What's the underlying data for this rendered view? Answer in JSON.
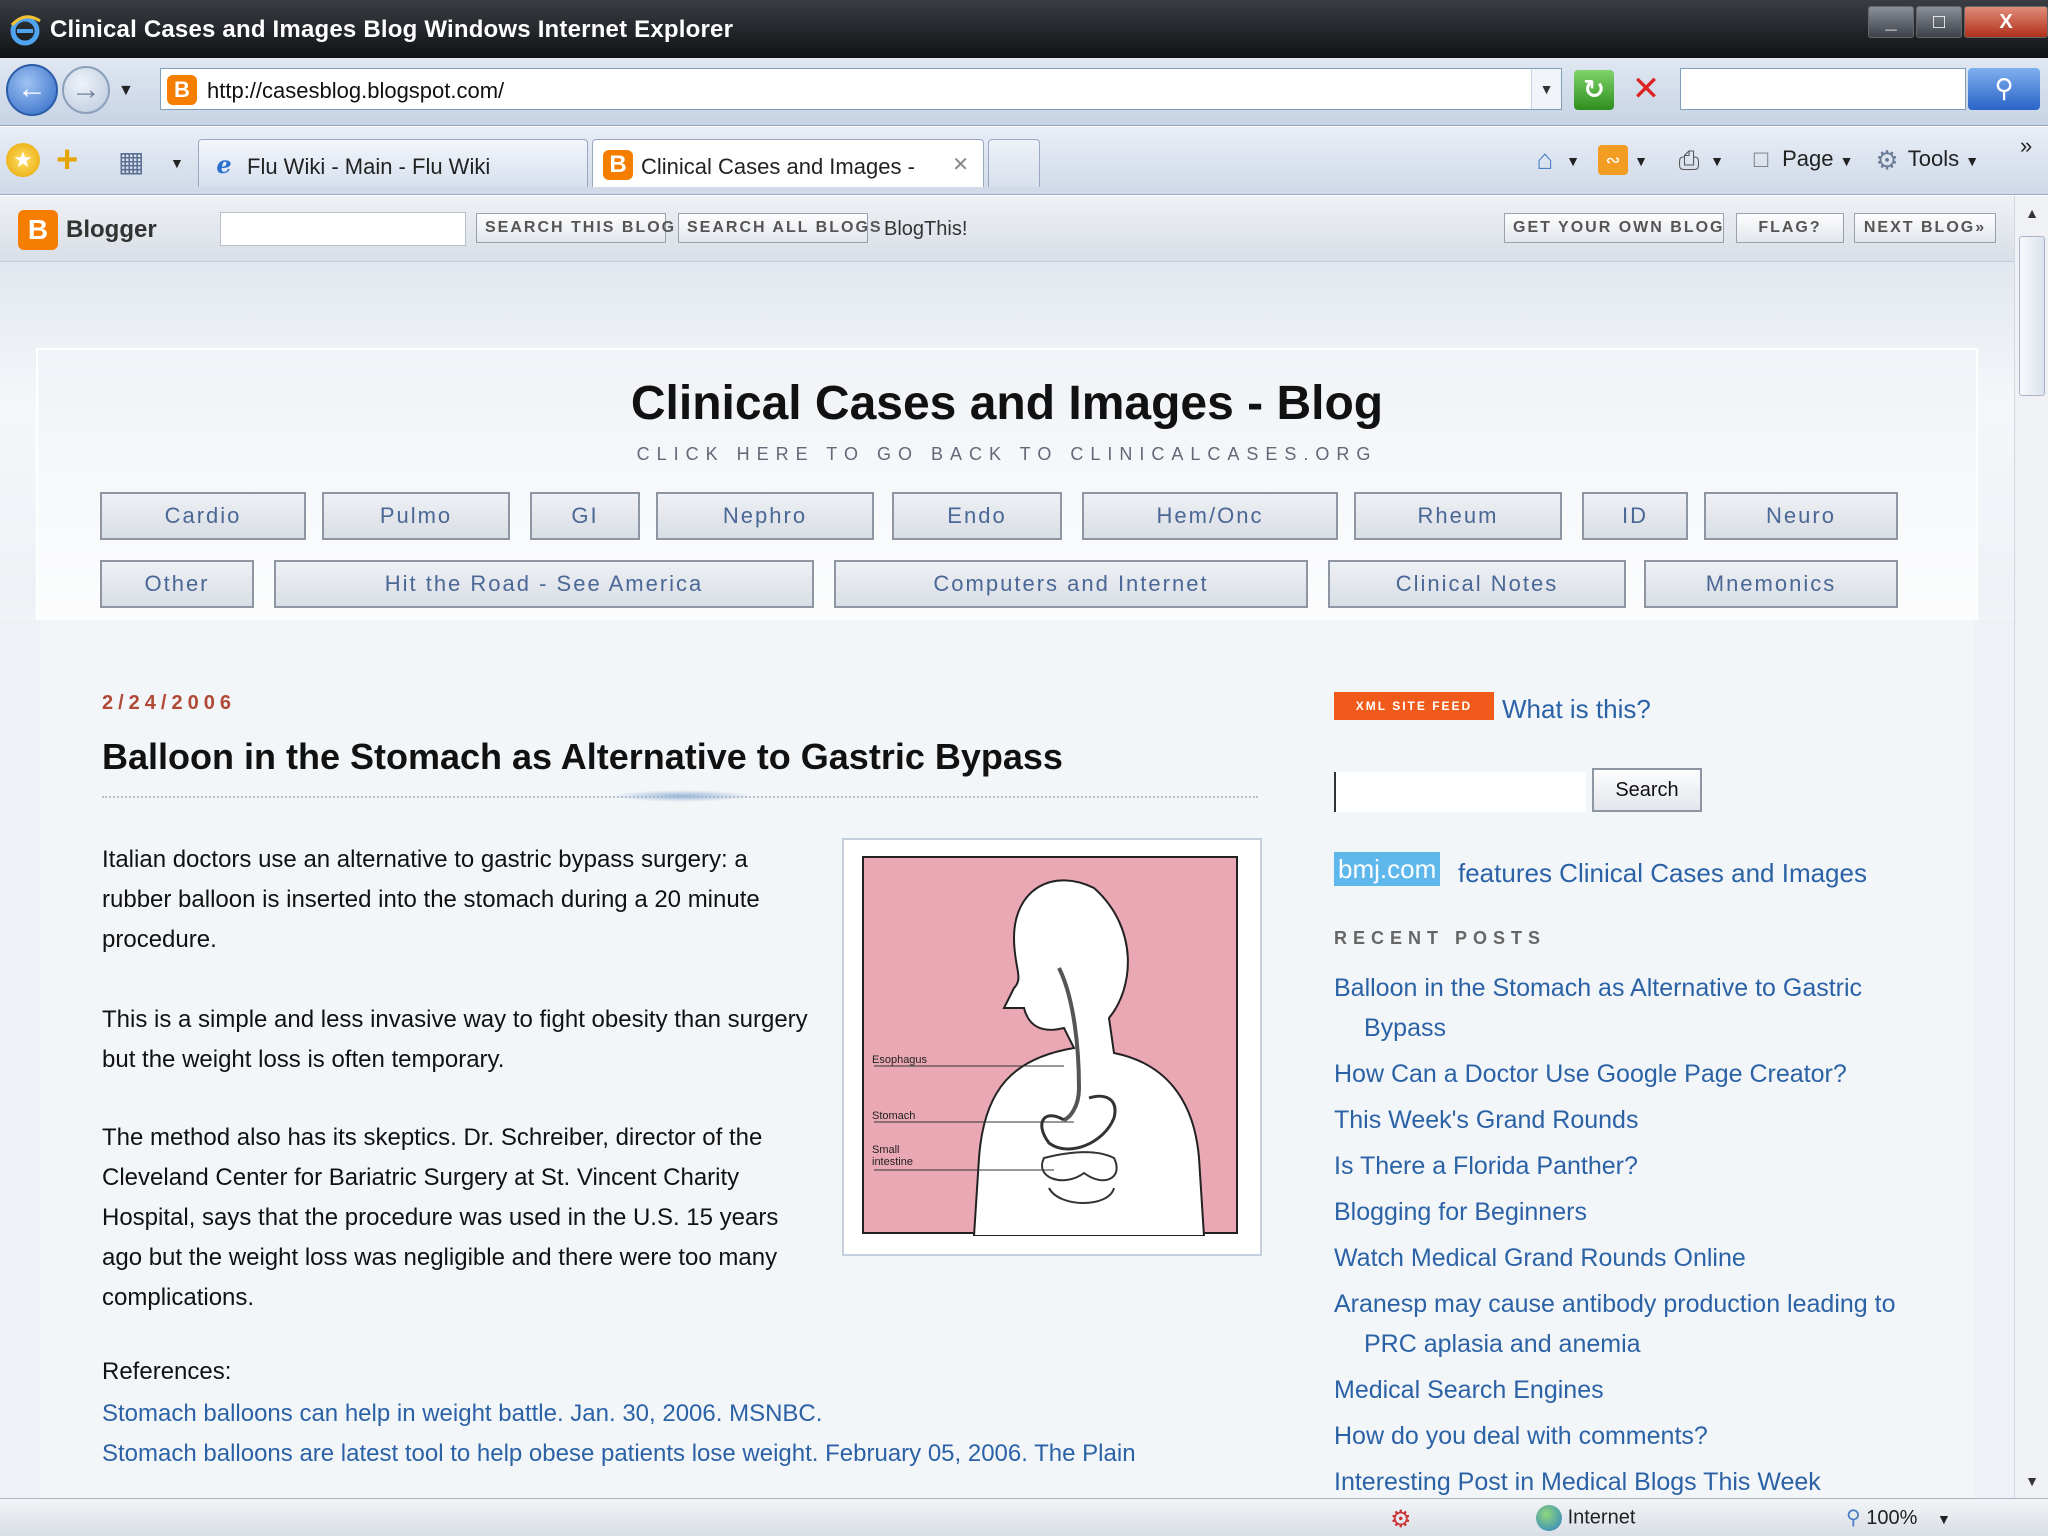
{
  "window": {
    "title": "Clinical Cases and Images  Blog   Windows Internet Explorer",
    "buttons": {
      "minimize": "_",
      "maximize": "□",
      "close": "X"
    }
  },
  "address_bar": {
    "url": "http://casesblog.blogspot.com/",
    "search_placeholder": ""
  },
  "tabs": [
    {
      "label": "Flu Wiki - Main - Flu Wiki",
      "icon": "ie-icon"
    },
    {
      "label": "Clinical Cases and Images - ",
      "icon": "blogger-icon",
      "active": true
    }
  ],
  "command_bar": {
    "page_label": "Page",
    "tools_label": "Tools"
  },
  "blogger_navbar": {
    "brand": "Blogger",
    "search_this_blog": "SEARCH THIS BLOG",
    "search_all_blogs": "SEARCH ALL BLOGS",
    "blogthis": "BlogThis!",
    "get_own_blog": "GET YOUR OWN BLOG",
    "flag": "FLAG?",
    "next_blog": "NEXT BLOG»"
  },
  "header": {
    "title": "Clinical Cases and Images - Blog",
    "description": "CLICK HERE TO GO BACK TO CLINICALCASES.ORG"
  },
  "categories_row1": [
    "Cardio",
    "Pulmo",
    "GI",
    "Nephro",
    "Endo",
    "Hem/Onc",
    "Rheum",
    "ID",
    "Neuro"
  ],
  "categories_row2": [
    "Other",
    "Hit the Road - See America",
    "Computers and Internet",
    "Clinical Notes",
    "Mnemonics"
  ],
  "post": {
    "date": "2/24/2006",
    "title": "Balloon in the Stomach as Alternative to Gastric Bypass",
    "paragraphs": [
      "Italian doctors use an alternative to gastric bypass surgery: a rubber balloon is inserted into the stomach during a 20 minute procedure.",
      "This is a simple and less invasive way to fight obesity than surgery but the weight loss is often temporary.",
      "The method also has its skeptics. Dr. Schreiber, director of the Cleveland Center for Bariatric Surgery at St. Vincent Charity Hospital, says that the procedure was used in the U.S. 15 years ago but the weight loss was negligible and there were too many complications."
    ],
    "figure_labels": [
      "Esophagus",
      "Stomach",
      "Small intestine"
    ],
    "references_label": "References:",
    "references": [
      "Stomach balloons can help in weight battle. Jan. 30, 2006. MSNBC.",
      "Stomach balloons are latest tool to help obese patients lose weight. February 05, 2006. The Plain"
    ]
  },
  "sidebar": {
    "feed_badge": "XML SITE FEED",
    "feed_what": "What is this?",
    "search_button": "Search",
    "bmj_link": "bmj.com",
    "bmj_text": "features Clinical Cases and Images",
    "recent_posts_title": "RECENT POSTS",
    "recent_posts": [
      "Balloon in the Stomach as Alternative to Gastric Bypass",
      "How Can a Doctor Use Google Page Creator?",
      "This Week's Grand Rounds",
      "Is There a Florida Panther?",
      "Blogging for Beginners",
      "Watch Medical Grand Rounds Online",
      "Aranesp may cause antibody production leading to PRC aplasia and anemia",
      "Medical Search Engines",
      "How do you deal with comments?",
      "Interesting Post in Medical Blogs This Week"
    ]
  },
  "status_bar": {
    "zone": "Internet",
    "zoom": "100%"
  }
}
